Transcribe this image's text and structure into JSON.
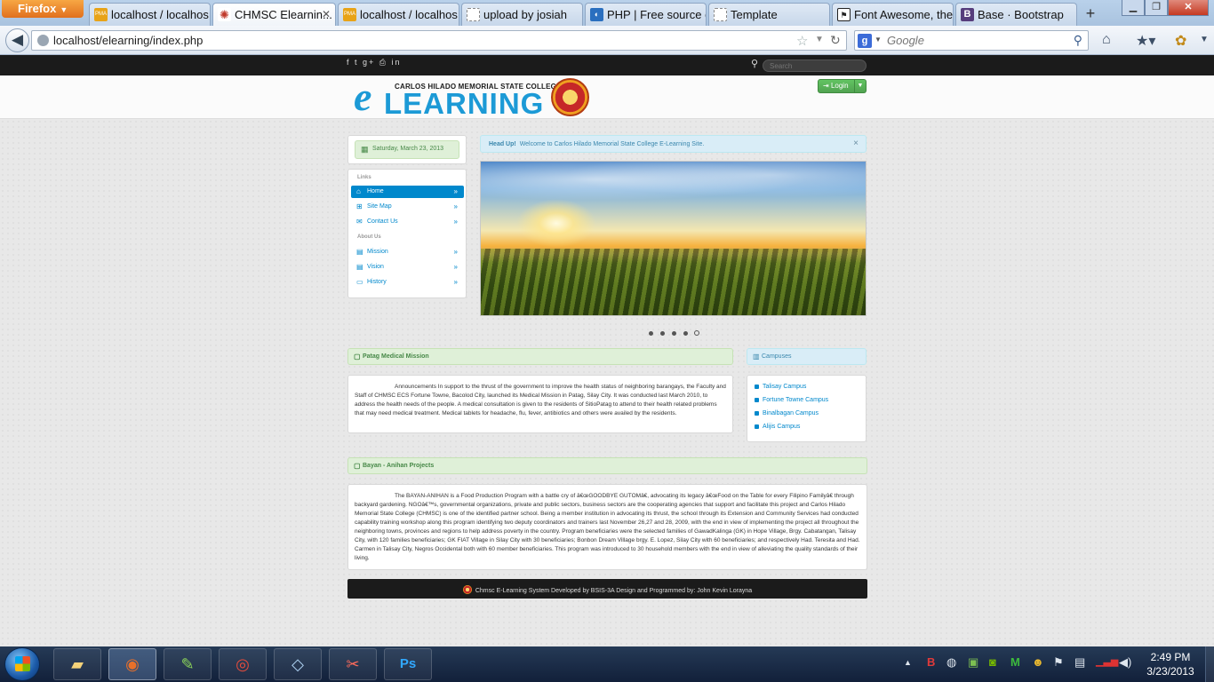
{
  "browser": {
    "app_button": "Firefox",
    "tabs": [
      {
        "label": "localhost / localhos...",
        "icon": "PMA",
        "icon_color": "#e8a317"
      },
      {
        "label": "CHMSC Elearnin...",
        "icon": "✺",
        "icon_color": "#c0392b"
      },
      {
        "label": "localhost / localhos...",
        "icon": "PMA",
        "icon_color": "#e8a317"
      },
      {
        "label": "upload by josiah",
        "icon": "",
        "icon_color": "#ffffff"
      },
      {
        "label": "PHP | Free source c...",
        "icon": "◐",
        "icon_color": "#2a6fbf"
      },
      {
        "label": "Template",
        "icon": "",
        "icon_color": "#ffffff"
      },
      {
        "label": "Font Awesome, the...",
        "icon": "⚑",
        "icon_color": "#222222"
      },
      {
        "label": "Base · Bootstrap",
        "icon": "B",
        "icon_color": "#563d7c"
      }
    ],
    "url": "localhost/elearning/index.php",
    "search_placeholder": "Google",
    "search_engine_letter": "g"
  },
  "site": {
    "search_placeholder": "Search",
    "social": "f  t  g+  ⎙  in",
    "logo": {
      "college": "CARLOS HILADO MEMORIAL STATE COLLEGE",
      "e": "e",
      "word": "LEARNING"
    },
    "login_label": "Login",
    "date": "Saturday, March 23, 2013",
    "links_header": "Links",
    "links": [
      {
        "label": "Home",
        "icon": "home-icon"
      },
      {
        "label": "Site Map",
        "icon": "sitemap-icon"
      },
      {
        "label": "Contact Us",
        "icon": "envelope-icon"
      }
    ],
    "about_header": "About Us",
    "about": [
      {
        "label": "Mission",
        "icon": "book-icon"
      },
      {
        "label": "Vision",
        "icon": "book-icon"
      },
      {
        "label": "History",
        "icon": "list-icon"
      }
    ],
    "alert": {
      "strong": "Head Up!",
      "text": "Welcome to Carlos Hilado Memorial State College E-Learning Site."
    },
    "carousel": {
      "slide_count": 5,
      "active_slide": 5
    },
    "sections": {
      "patag": {
        "title": "Patag Medical Mission",
        "body": "Announcements In support to the thrust of the government to improve the health status of neighboring barangays, the Faculty and Staff of CHMSC ECS Fortune Towne, Bacolod City, launched its Medical Mission in Patag, Silay City. It was conducted last March 2010, to address the health needs of the people. A medical consultation is given to the residents of SitioPatag to attend to their health related problems that may need medical treatment. Medical tablets for headache, flu, fever, antibiotics and others were availed by the residents."
      },
      "campuses": {
        "title": "Campuses",
        "items": [
          "Talisay Campus",
          "Fortune Towne Campus",
          "Binalbagan Campus",
          "Alijis Campus"
        ]
      },
      "bayan": {
        "title": "Bayan - Anihan Projects",
        "body": "The BAYAN-ANIHAN is a Food Production Program with a battle cry of â€œGOODBYE GUTOMâ€, advocating its legacy â€œFood on the Table for every Filipino Familyâ€ through backyard gardening. NGOâ€™s, governmental organizations, private and public sectors, business sectors are the cooperating agencies that support and facilitate this project and Carlos Hilado Memorial State College (CHMSC) is one of the identified partner school. Being a member institution in advocating its thrust, the school through its Extension and Community Services had conducted capability training workshop along this program identifying two deputy coordinators and trainers last November 26,27 and 28, 2009, with the end in view of implementing the project all throughout the neighboring towns, provinces and regions to help address poverty in the country. Program beneficiaries were the selected families of GawadKalinga (GK) in Hope Village, Brgy. Cabatangan, Talisay City, with 120 families beneficiaries; GK FIAT Village in Silay City with 30 beneficiaries; Bonbon Dream Village brgy. E. Lopez, Silay City with 60 beneficiaries; and respectively Had. Teresita and Had. Carmen in Talisay City, Negros Occidental both with 60 member beneficiaries. This program was introduced to 30 household members with the end in view of alleviating the quality standards of their living."
      }
    },
    "footer": "Chmsc E-Learning System Developed by BSIS-3A Design and Programmed by: John Kevin Lorayna"
  },
  "taskbar": {
    "clock_time": "2:49 PM",
    "clock_date": "3/23/2013"
  },
  "colors": {
    "brand_blue": "#1c9ad6",
    "link_blue": "#0088cc",
    "success_green": "#468847",
    "info_blue": "#3a87ad"
  }
}
